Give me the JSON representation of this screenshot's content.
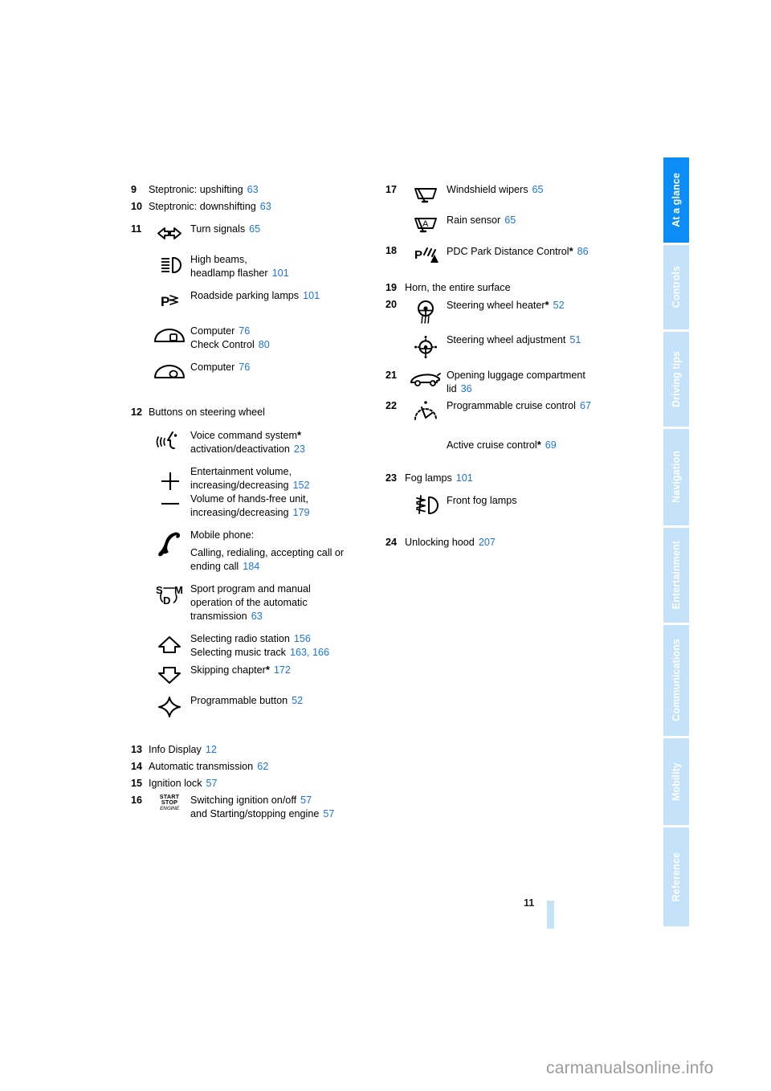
{
  "page": {
    "number": "11",
    "watermark": "carmanualsonline.info"
  },
  "sidebar": {
    "tabs": [
      {
        "label": "At a glance",
        "active": true
      },
      {
        "label": "Controls",
        "active": false
      },
      {
        "label": "Driving tips",
        "active": false
      },
      {
        "label": "Navigation",
        "active": false
      },
      {
        "label": "Entertainment",
        "active": false
      },
      {
        "label": "Communications",
        "active": false
      },
      {
        "label": "Mobility",
        "active": false
      },
      {
        "label": "Reference",
        "active": false
      }
    ],
    "active_color": "#0c8cf5",
    "inactive_color": "#c5e2fb"
  },
  "left_column": {
    "items": [
      {
        "number": "9",
        "icon": "",
        "lines": [
          {
            "text": "Steptronic: upshifting",
            "page": "63"
          }
        ]
      },
      {
        "number": "10",
        "icon": "",
        "lines": [
          {
            "text": "Steptronic: downshifting",
            "page": "63"
          }
        ]
      },
      {
        "number": "11",
        "icon": "turn-signals-icon",
        "lines": [
          {
            "text": "Turn signals",
            "page": "65"
          }
        ]
      },
      {
        "number": "",
        "icon": "high-beams-icon",
        "lines": [
          {
            "text": "High beams,",
            "page": ""
          },
          {
            "text": "headlamp flasher",
            "page": "101"
          }
        ]
      },
      {
        "number": "",
        "icon": "roadside-parking-lamps-icon",
        "lines": [
          {
            "text": "Roadside parking lamps",
            "page": "101"
          }
        ]
      },
      {
        "number": "",
        "icon": "computer-check-control-icon",
        "lines": [
          {
            "text": "Computer",
            "page": "76"
          },
          {
            "text": "Check Control",
            "page": "80"
          }
        ]
      },
      {
        "number": "",
        "icon": "computer-icon",
        "lines": [
          {
            "text": "Computer",
            "page": "76"
          }
        ]
      },
      {
        "number": "12",
        "icon": "",
        "lines": [
          {
            "text": "Buttons on steering wheel",
            "page": ""
          }
        ]
      },
      {
        "number": "",
        "icon": "voice-command-icon",
        "lines": [
          {
            "text": "Voice command system",
            "page": "",
            "star": true
          },
          {
            "text": "activation/deactivation",
            "page": "23"
          }
        ]
      },
      {
        "number": "",
        "icon": "volume-plus-minus-icon",
        "lines": [
          {
            "text": "Entertainment volume,",
            "page": ""
          },
          {
            "text": "increasing/decreasing",
            "page": "152"
          },
          {
            "text": "Volume of hands-free unit,",
            "page": ""
          },
          {
            "text": "increasing/decreasing",
            "page": "179"
          }
        ]
      },
      {
        "number": "",
        "icon": "telephone-handset-icon",
        "lines": [
          {
            "text": "Mobile phone:",
            "page": ""
          },
          {
            "text": "Calling, redialing, accepting call or",
            "page": ""
          },
          {
            "text": "ending call",
            "page": "184"
          }
        ]
      },
      {
        "number": "",
        "icon": "sport-manual-transmission-icon",
        "lines": [
          {
            "text": "Sport program and manual",
            "page": ""
          },
          {
            "text": "operation of the automatic",
            "page": ""
          },
          {
            "text": "transmission",
            "page": "63"
          }
        ]
      },
      {
        "number": "",
        "icon": "arrow-up-icon",
        "lines": [
          {
            "text": "Selecting radio station",
            "page": "156"
          },
          {
            "text": "Selecting music track",
            "page": "163, 166"
          }
        ]
      },
      {
        "number": "",
        "icon": "arrow-down-icon",
        "lines": [
          {
            "text": "Skipping chapter",
            "page": "172",
            "star": true
          }
        ]
      },
      {
        "number": "",
        "icon": "programmable-star-icon",
        "lines": [
          {
            "text": "Programmable button",
            "page": "52"
          }
        ]
      },
      {
        "number": "13",
        "icon": "",
        "lines": [
          {
            "text": "Info Display",
            "page": "12"
          }
        ]
      },
      {
        "number": "14",
        "icon": "",
        "lines": [
          {
            "text": "Automatic transmission",
            "page": "62"
          }
        ]
      },
      {
        "number": "15",
        "icon": "",
        "lines": [
          {
            "text": "Ignition lock",
            "page": "57"
          }
        ]
      },
      {
        "number": "16",
        "icon": "start-stop-engine-icon",
        "icon_text": {
          "line1": "START",
          "line2": "STOP",
          "line3": "ENGINE"
        },
        "lines": [
          {
            "text": "Switching ignition on/off",
            "page": "57"
          },
          {
            "text": "and Starting/stopping engine",
            "page": "57"
          }
        ]
      }
    ]
  },
  "right_column": {
    "items": [
      {
        "number": "17",
        "icon": "windshield-wiper-icon",
        "lines": [
          {
            "text": "Windshield wipers",
            "page": "65"
          }
        ]
      },
      {
        "number": "",
        "icon": "rain-sensor-icon",
        "lines": [
          {
            "text": "Rain sensor",
            "page": "65"
          }
        ]
      },
      {
        "number": "18",
        "icon": "pdc-park-distance-icon",
        "lines": [
          {
            "text": "PDC Park Distance Control",
            "page": "86",
            "star": true
          }
        ]
      },
      {
        "number": "19",
        "icon": "",
        "lines": [
          {
            "text": "Horn, the entire surface",
            "page": ""
          }
        ]
      },
      {
        "number": "20",
        "icon": "steering-wheel-heater-icon",
        "lines": [
          {
            "text": "Steering wheel heater",
            "page": "52",
            "star": true
          }
        ]
      },
      {
        "number": "",
        "icon": "steering-wheel-adjustment-icon",
        "lines": [
          {
            "text": "Steering wheel adjustment",
            "page": "51"
          }
        ]
      },
      {
        "number": "21",
        "icon": "luggage-compartment-icon",
        "lines": [
          {
            "text": "Opening luggage compartment",
            "page": ""
          },
          {
            "text": "lid",
            "page": "36"
          }
        ]
      },
      {
        "number": "22",
        "icon": "cruise-control-icon",
        "lines": [
          {
            "text": "Programmable cruise control",
            "page": "67"
          }
        ]
      },
      {
        "number": "",
        "icon": "",
        "lines": [
          {
            "text": "Active cruise control",
            "page": "69",
            "star": true
          }
        ]
      },
      {
        "number": "23",
        "icon": "",
        "lines": [
          {
            "text": "Fog lamps",
            "page": "101"
          }
        ]
      },
      {
        "number": "",
        "icon": "front-fog-lamps-icon",
        "lines": [
          {
            "text": "Front fog lamps",
            "page": ""
          }
        ]
      },
      {
        "number": "24",
        "icon": "",
        "lines": [
          {
            "text": "Unlocking hood",
            "page": "207"
          }
        ]
      }
    ]
  }
}
